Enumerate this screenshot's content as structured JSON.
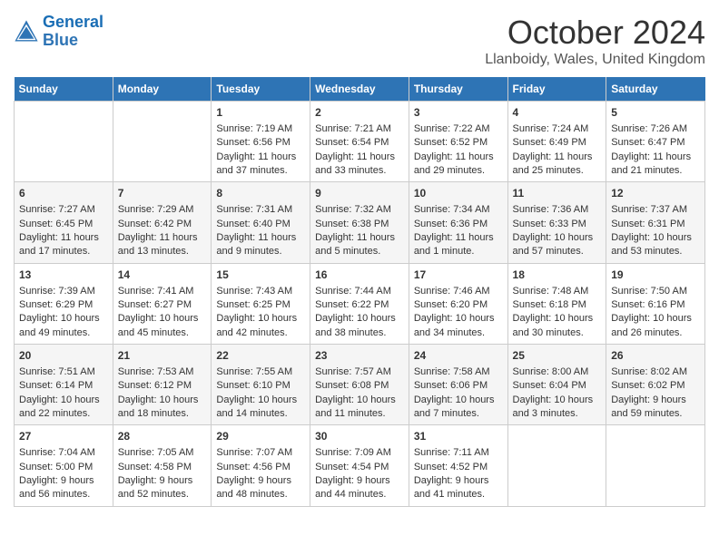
{
  "header": {
    "logo_line1": "General",
    "logo_line2": "Blue",
    "month": "October 2024",
    "location": "Llanboidy, Wales, United Kingdom"
  },
  "days_of_week": [
    "Sunday",
    "Monday",
    "Tuesday",
    "Wednesday",
    "Thursday",
    "Friday",
    "Saturday"
  ],
  "weeks": [
    [
      {
        "day": "",
        "info": ""
      },
      {
        "day": "",
        "info": ""
      },
      {
        "day": "1",
        "info": "Sunrise: 7:19 AM\nSunset: 6:56 PM\nDaylight: 11 hours and 37 minutes."
      },
      {
        "day": "2",
        "info": "Sunrise: 7:21 AM\nSunset: 6:54 PM\nDaylight: 11 hours and 33 minutes."
      },
      {
        "day": "3",
        "info": "Sunrise: 7:22 AM\nSunset: 6:52 PM\nDaylight: 11 hours and 29 minutes."
      },
      {
        "day": "4",
        "info": "Sunrise: 7:24 AM\nSunset: 6:49 PM\nDaylight: 11 hours and 25 minutes."
      },
      {
        "day": "5",
        "info": "Sunrise: 7:26 AM\nSunset: 6:47 PM\nDaylight: 11 hours and 21 minutes."
      }
    ],
    [
      {
        "day": "6",
        "info": "Sunrise: 7:27 AM\nSunset: 6:45 PM\nDaylight: 11 hours and 17 minutes."
      },
      {
        "day": "7",
        "info": "Sunrise: 7:29 AM\nSunset: 6:42 PM\nDaylight: 11 hours and 13 minutes."
      },
      {
        "day": "8",
        "info": "Sunrise: 7:31 AM\nSunset: 6:40 PM\nDaylight: 11 hours and 9 minutes."
      },
      {
        "day": "9",
        "info": "Sunrise: 7:32 AM\nSunset: 6:38 PM\nDaylight: 11 hours and 5 minutes."
      },
      {
        "day": "10",
        "info": "Sunrise: 7:34 AM\nSunset: 6:36 PM\nDaylight: 11 hours and 1 minute."
      },
      {
        "day": "11",
        "info": "Sunrise: 7:36 AM\nSunset: 6:33 PM\nDaylight: 10 hours and 57 minutes."
      },
      {
        "day": "12",
        "info": "Sunrise: 7:37 AM\nSunset: 6:31 PM\nDaylight: 10 hours and 53 minutes."
      }
    ],
    [
      {
        "day": "13",
        "info": "Sunrise: 7:39 AM\nSunset: 6:29 PM\nDaylight: 10 hours and 49 minutes."
      },
      {
        "day": "14",
        "info": "Sunrise: 7:41 AM\nSunset: 6:27 PM\nDaylight: 10 hours and 45 minutes."
      },
      {
        "day": "15",
        "info": "Sunrise: 7:43 AM\nSunset: 6:25 PM\nDaylight: 10 hours and 42 minutes."
      },
      {
        "day": "16",
        "info": "Sunrise: 7:44 AM\nSunset: 6:22 PM\nDaylight: 10 hours and 38 minutes."
      },
      {
        "day": "17",
        "info": "Sunrise: 7:46 AM\nSunset: 6:20 PM\nDaylight: 10 hours and 34 minutes."
      },
      {
        "day": "18",
        "info": "Sunrise: 7:48 AM\nSunset: 6:18 PM\nDaylight: 10 hours and 30 minutes."
      },
      {
        "day": "19",
        "info": "Sunrise: 7:50 AM\nSunset: 6:16 PM\nDaylight: 10 hours and 26 minutes."
      }
    ],
    [
      {
        "day": "20",
        "info": "Sunrise: 7:51 AM\nSunset: 6:14 PM\nDaylight: 10 hours and 22 minutes."
      },
      {
        "day": "21",
        "info": "Sunrise: 7:53 AM\nSunset: 6:12 PM\nDaylight: 10 hours and 18 minutes."
      },
      {
        "day": "22",
        "info": "Sunrise: 7:55 AM\nSunset: 6:10 PM\nDaylight: 10 hours and 14 minutes."
      },
      {
        "day": "23",
        "info": "Sunrise: 7:57 AM\nSunset: 6:08 PM\nDaylight: 10 hours and 11 minutes."
      },
      {
        "day": "24",
        "info": "Sunrise: 7:58 AM\nSunset: 6:06 PM\nDaylight: 10 hours and 7 minutes."
      },
      {
        "day": "25",
        "info": "Sunrise: 8:00 AM\nSunset: 6:04 PM\nDaylight: 10 hours and 3 minutes."
      },
      {
        "day": "26",
        "info": "Sunrise: 8:02 AM\nSunset: 6:02 PM\nDaylight: 9 hours and 59 minutes."
      }
    ],
    [
      {
        "day": "27",
        "info": "Sunrise: 7:04 AM\nSunset: 5:00 PM\nDaylight: 9 hours and 56 minutes."
      },
      {
        "day": "28",
        "info": "Sunrise: 7:05 AM\nSunset: 4:58 PM\nDaylight: 9 hours and 52 minutes."
      },
      {
        "day": "29",
        "info": "Sunrise: 7:07 AM\nSunset: 4:56 PM\nDaylight: 9 hours and 48 minutes."
      },
      {
        "day": "30",
        "info": "Sunrise: 7:09 AM\nSunset: 4:54 PM\nDaylight: 9 hours and 44 minutes."
      },
      {
        "day": "31",
        "info": "Sunrise: 7:11 AM\nSunset: 4:52 PM\nDaylight: 9 hours and 41 minutes."
      },
      {
        "day": "",
        "info": ""
      },
      {
        "day": "",
        "info": ""
      }
    ]
  ]
}
